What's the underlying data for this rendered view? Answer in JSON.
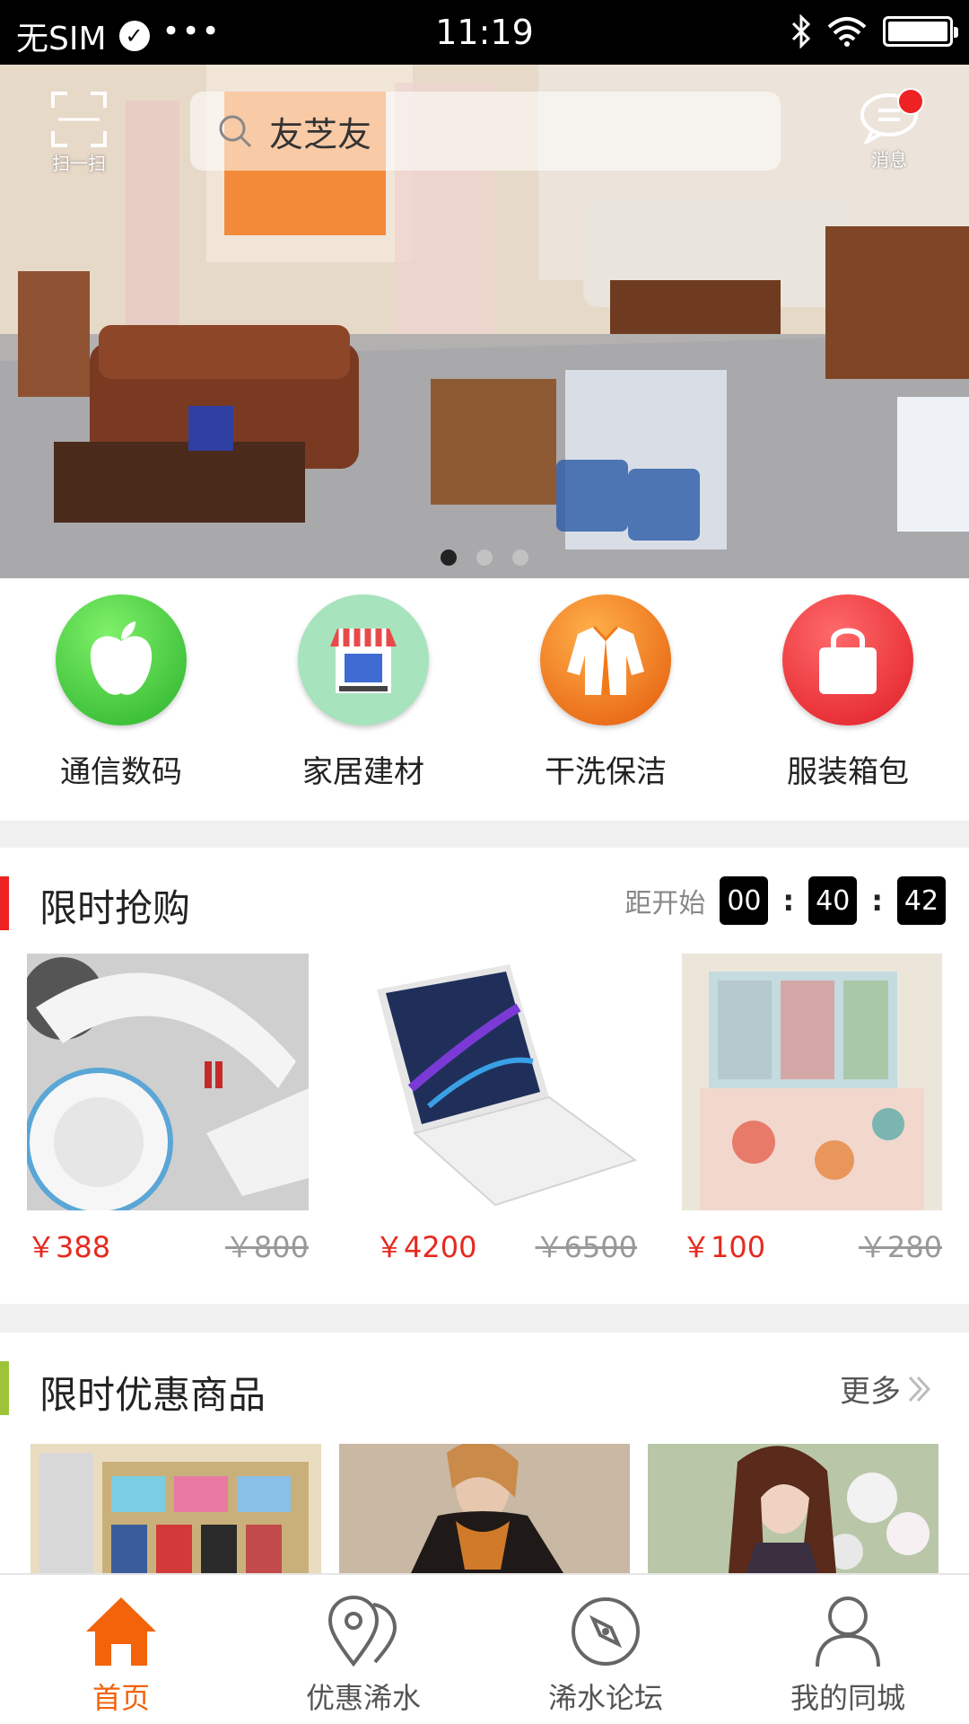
{
  "status_bar": {
    "carrier": "无SIM",
    "dots": "•••",
    "time": "11:19"
  },
  "header": {
    "scan_label": "扫一扫",
    "search_placeholder": "友芝友",
    "message_label": "消息"
  },
  "banner": {
    "slides_total": 3,
    "active_index": 0
  },
  "categories": [
    {
      "label": "通信数码",
      "icon": "apple-icon",
      "color": "#3cc23a"
    },
    {
      "label": "家居建材",
      "icon": "store-icon",
      "color": "#a7e3bd"
    },
    {
      "label": "干洗保洁",
      "icon": "shirt-icon",
      "color": "#f57a18"
    },
    {
      "label": "服装箱包",
      "icon": "bag-icon",
      "color": "#ec2d35"
    }
  ],
  "flash_sale": {
    "title": "限时抢购",
    "countdown_label": "距开始",
    "hours": "00",
    "minutes": "40",
    "seconds": "42",
    "products": [
      {
        "name": "headphones",
        "price": "￥388",
        "original_price": "￥800"
      },
      {
        "name": "laptop",
        "price": "￥4200",
        "original_price": "￥6500"
      },
      {
        "name": "bedding",
        "price": "￥100",
        "original_price": "￥280"
      }
    ]
  },
  "discount": {
    "title": "限时优惠商品",
    "more_label": "更多"
  },
  "tabbar": [
    {
      "label": "首页",
      "icon": "home-icon",
      "active": true
    },
    {
      "label": "优惠浠水",
      "icon": "map-pin-icon",
      "active": false
    },
    {
      "label": "浠水论坛",
      "icon": "compass-icon",
      "active": false
    },
    {
      "label": "我的同城",
      "icon": "user-icon",
      "active": false
    }
  ],
  "colors": {
    "accent": "#f2630a",
    "price_red": "#e52a1f",
    "flash_bar": "#ee2222",
    "discount_bar": "#9cc33a"
  }
}
